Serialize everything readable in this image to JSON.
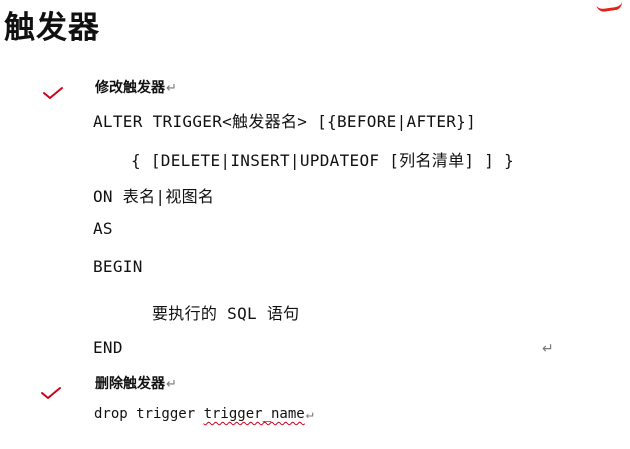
{
  "title": "触发器",
  "alter_section": {
    "heading": "修改触发器",
    "lines": [
      "ALTER TRIGGER<触发器名> [{BEFORE|AFTER}]",
      "{ [DELETE|INSERT|UPDATEOF [列名清单] ] }",
      "ON 表名|视图名",
      "AS",
      "BEGIN",
      "要执行的 SQL 语句",
      "END"
    ]
  },
  "drop_section": {
    "heading": "删除触发器",
    "prefix": "drop trigger ",
    "trigger_name": "trigger_name"
  },
  "para_mark": "↵",
  "colors": {
    "check": "#d0021b",
    "accent": "#e2231a"
  }
}
